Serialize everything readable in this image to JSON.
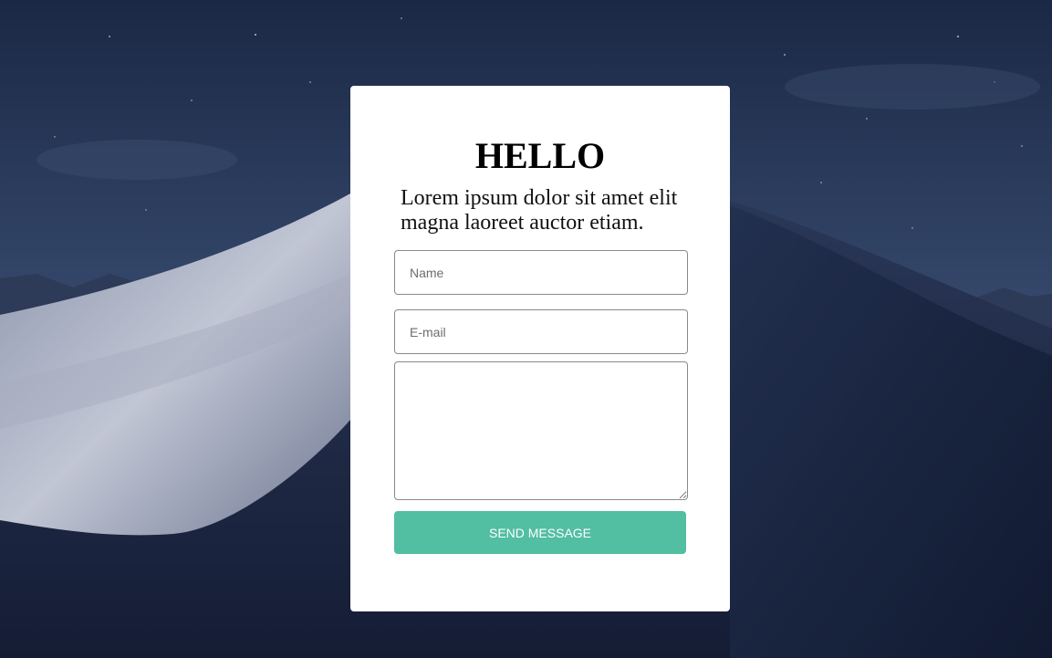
{
  "form": {
    "title": "HELLO",
    "subtitle": "Lorem ipsum dolor sit amet elit magna laoreet auctor etiam.",
    "name_placeholder": "Name",
    "email_placeholder": "E-mail",
    "message_placeholder": "",
    "send_label": "SEND MESSAGE"
  },
  "colors": {
    "button": "#52bea2",
    "card": "#ffffff",
    "night_sky": "#1d2a47"
  }
}
